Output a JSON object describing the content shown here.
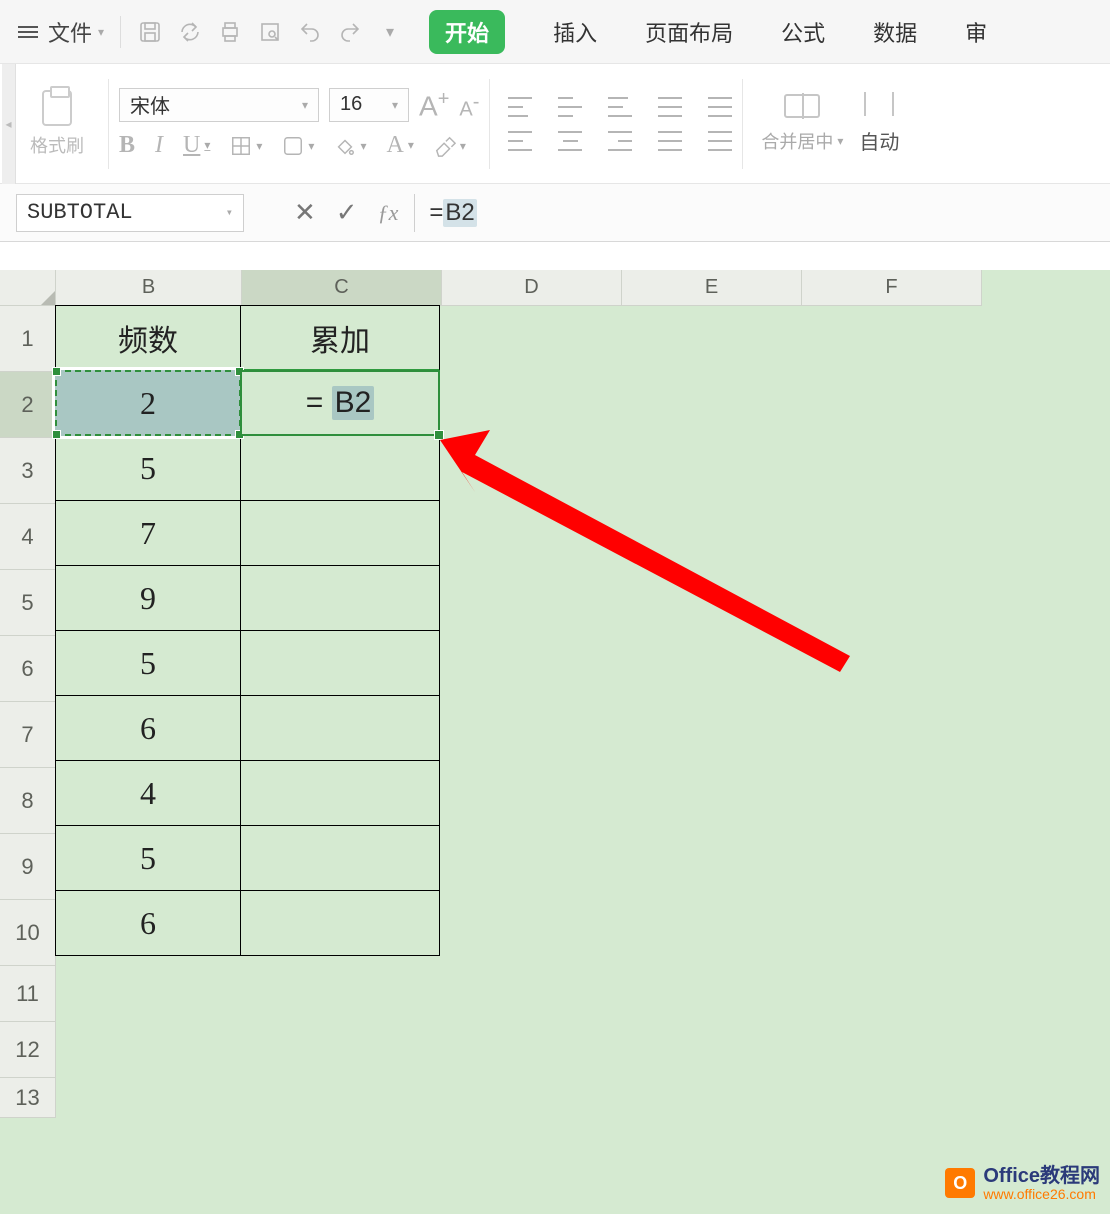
{
  "menu": {
    "file": "文件"
  },
  "tabs": {
    "start": "开始",
    "insert": "插入",
    "layout": "页面布局",
    "formula": "公式",
    "data": "数据",
    "extra": "审"
  },
  "ribbon": {
    "formatPainter": "格式刷",
    "fontName": "宋体",
    "fontSize": "16",
    "mergeCenter": "合并居中",
    "autoWrap": "自动"
  },
  "nameBox": "SUBTOTAL",
  "formulaBar": {
    "prefix": "=",
    "ref": "B2"
  },
  "columns": [
    "B",
    "C",
    "D",
    "E",
    "F"
  ],
  "rows": [
    "1",
    "2",
    "3",
    "4",
    "5",
    "6",
    "7",
    "8",
    "9",
    "10",
    "11",
    "12",
    "13"
  ],
  "table": {
    "headers": {
      "B": "频数",
      "C": "累加"
    },
    "B": [
      "2",
      "5",
      "7",
      "9",
      "5",
      "6",
      "4",
      "5",
      "6"
    ],
    "C2": {
      "eq": "=",
      "ref": "B2"
    }
  },
  "watermark": {
    "badge": "O",
    "line1": "Office教程网",
    "line2": "www.office26.com"
  }
}
